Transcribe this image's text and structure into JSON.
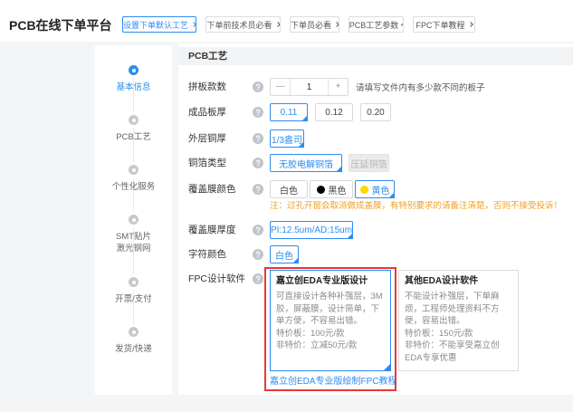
{
  "colors": {
    "accent": "#2d8cf0",
    "note": "#f0a020",
    "highlight_box": "#e53935"
  },
  "header": {
    "title": "PCB在线下单平台",
    "tabs": [
      {
        "label": "设置下单默认工艺",
        "active": true
      },
      {
        "label": "下单前技术员必看",
        "active": false
      },
      {
        "label": "下单员必看",
        "active": false
      },
      {
        "label": "PCB工艺参数",
        "active": false
      },
      {
        "label": "FPC下单教程",
        "active": false
      }
    ]
  },
  "steps": [
    {
      "label": "基本信息",
      "active": true
    },
    {
      "label": "PCB工艺",
      "active": false
    },
    {
      "label": "个性化服务",
      "active": false
    },
    {
      "label": "SMT贴片",
      "label2": "激光钢网",
      "active": false
    },
    {
      "label": "开票/支付",
      "active": false
    },
    {
      "label": "发货/快递",
      "active": false
    }
  ],
  "section": {
    "title": "PCB工艺"
  },
  "form": {
    "panel_count": {
      "label": "拼板款数",
      "minus": "—",
      "value": "1",
      "plus": "+",
      "hint": "请填写文件内有多少款不同的板子"
    },
    "thickness": {
      "label": "成品板厚",
      "options": [
        {
          "label": "0.11",
          "selected": true
        },
        {
          "label": "0.12",
          "selected": false
        },
        {
          "label": "0.20",
          "selected": false
        }
      ]
    },
    "copper": {
      "label": "外层铜厚",
      "options": [
        {
          "label": "1/3盎司",
          "selected": true
        }
      ]
    },
    "foil": {
      "label": "铜箔类型",
      "options": [
        {
          "label": "无胶电解铜箔",
          "selected": true,
          "disabled": false
        },
        {
          "label": "压延铜箔",
          "selected": false,
          "disabled": true
        }
      ]
    },
    "coverlay_color": {
      "label": "覆盖膜颜色",
      "options": [
        {
          "label": "白色",
          "selected": false
        },
        {
          "label": "黑色",
          "swatch": "#000000",
          "selected": false
        },
        {
          "label": "黄色",
          "swatch": "#ffd600",
          "selected": true
        }
      ],
      "note": "注：过孔开窗会取消做成盖膜，有特别要求的请备注清楚，否则不接受投诉！"
    },
    "coverlay_thickness": {
      "label": "覆盖膜厚度",
      "options": [
        {
          "label": "PI:12.5um/AD:15um",
          "selected": true
        }
      ]
    },
    "silkscreen": {
      "label": "字符颜色",
      "options": [
        {
          "label": "白色",
          "selected": true
        }
      ]
    },
    "fpc_software": {
      "label": "FPC设计软件",
      "cards": [
        {
          "title": "嘉立创EDA专业版设计",
          "desc": "可直接设计各种补强层，3M胶，屏蔽膜，设计简单，下单方便，不容易出错。",
          "special": "特价板：100元/款",
          "normal": "非特价：立减50元/款",
          "selected": true
        },
        {
          "title": "其他EDA设计软件",
          "desc": "不能设计补强层，下单麻烦，工程师处理资料不方便，容易出错。",
          "special": "特价板：150元/款",
          "normal": "非特价：不能享受嘉立创EDA专享优惠",
          "selected": false
        }
      ],
      "tutorial_link": "嘉立创EDA专业版绘制FPC教程"
    }
  }
}
